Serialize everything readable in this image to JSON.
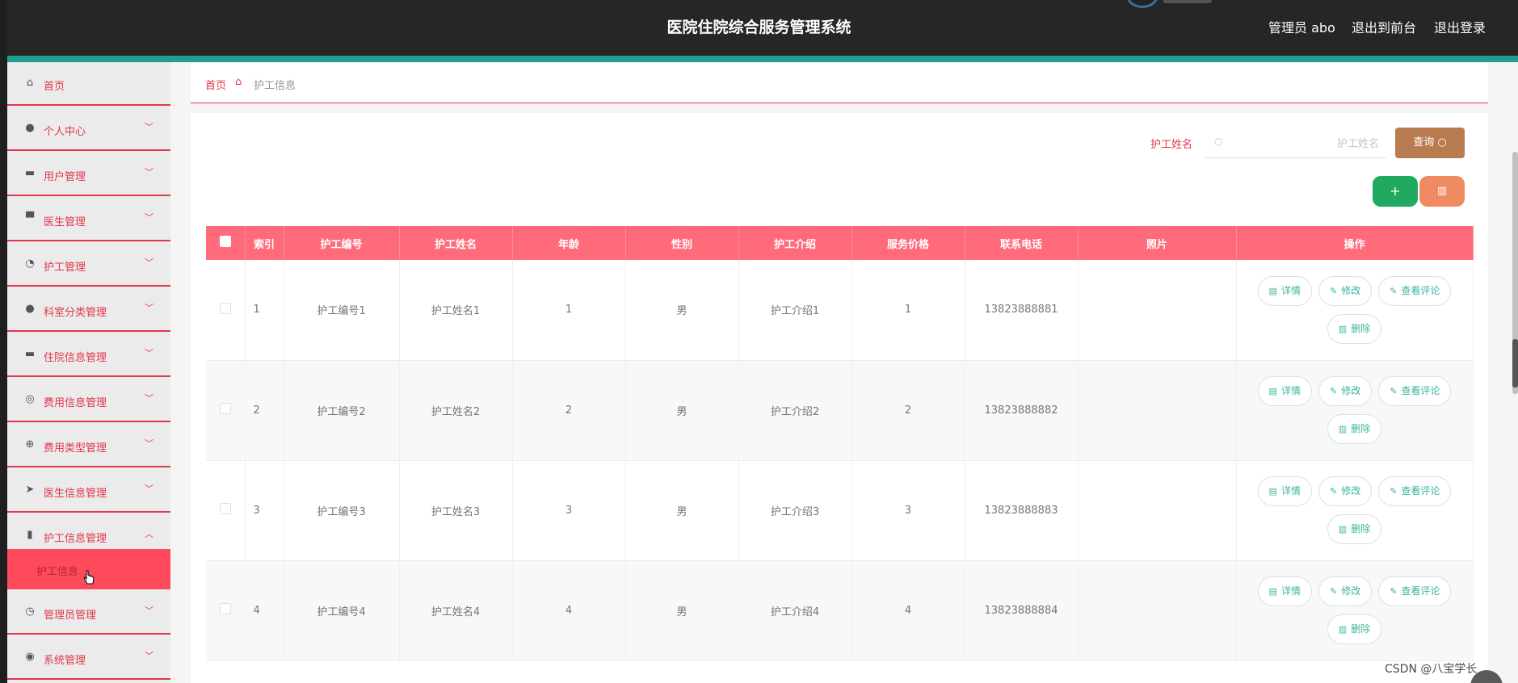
{
  "header": {
    "title": "医院住院综合服务管理系统",
    "admin_label": "管理员 abo",
    "to_front": "退出到前台",
    "logout": "退出登录"
  },
  "sidebar": {
    "items": [
      {
        "label": "首页",
        "icon": "home-icon",
        "glyph": "⌂",
        "has_chevron": false
      },
      {
        "label": "个人中心",
        "icon": "user-icon",
        "glyph": "●",
        "has_chevron": true
      },
      {
        "label": "用户管理",
        "icon": "ticket-icon",
        "glyph": "▬",
        "has_chevron": true
      },
      {
        "label": "医生管理",
        "icon": "monitor-icon",
        "glyph": "▀",
        "has_chevron": true
      },
      {
        "label": "护工管理",
        "icon": "dashboard-icon",
        "glyph": "◔",
        "has_chevron": true
      },
      {
        "label": "科室分类管理",
        "icon": "user-solid-icon",
        "glyph": "●",
        "has_chevron": true
      },
      {
        "label": "住院信息管理",
        "icon": "message-icon",
        "glyph": "▬",
        "has_chevron": true
      },
      {
        "label": "费用信息管理",
        "icon": "microphone-icon",
        "glyph": "◎",
        "has_chevron": true
      },
      {
        "label": "费用类型管理",
        "icon": "basketball-icon",
        "glyph": "⊕",
        "has_chevron": true
      },
      {
        "label": "医生信息管理",
        "icon": "send-icon",
        "glyph": "➤",
        "has_chevron": true
      },
      {
        "label": "护工信息管理",
        "icon": "bar-chart-icon",
        "glyph": "▮",
        "has_chevron": true,
        "expanded": true
      },
      {
        "label": "管理员管理",
        "icon": "clock-icon",
        "glyph": "◷",
        "has_chevron": true
      },
      {
        "label": "系统管理",
        "icon": "lifebuoy-icon",
        "glyph": "◉",
        "has_chevron": true
      }
    ],
    "submenu_active": "护工信息"
  },
  "breadcrumb": {
    "home": "首页",
    "current": "护工信息"
  },
  "search": {
    "label": "护工姓名",
    "placeholder": "护工姓名",
    "button": "查询"
  },
  "toolbar": {
    "add": "+",
    "delete_icon": "trash-icon"
  },
  "table": {
    "columns": [
      "索引",
      "护工编号",
      "护工姓名",
      "年龄",
      "性别",
      "护工介绍",
      "服务价格",
      "联系电话",
      "照片",
      "操作"
    ],
    "rows": [
      {
        "index": "1",
        "code": "护工编号1",
        "name": "护工姓名1",
        "age": "1",
        "gender": "男",
        "intro": "护工介绍1",
        "price": "1",
        "phone": "13823888881",
        "photo": ""
      },
      {
        "index": "2",
        "code": "护工编号2",
        "name": "护工姓名2",
        "age": "2",
        "gender": "男",
        "intro": "护工介绍2",
        "price": "2",
        "phone": "13823888882",
        "photo": ""
      },
      {
        "index": "3",
        "code": "护工编号3",
        "name": "护工姓名3",
        "age": "3",
        "gender": "男",
        "intro": "护工介绍3",
        "price": "3",
        "phone": "13823888883",
        "photo": ""
      },
      {
        "index": "4",
        "code": "护工编号4",
        "name": "护工姓名4",
        "age": "4",
        "gender": "男",
        "intro": "护工介绍4",
        "price": "4",
        "phone": "13823888884",
        "photo": ""
      }
    ],
    "actions": {
      "detail": "详情",
      "edit": "修改",
      "comments": "查看评论",
      "delete": "删除"
    }
  },
  "watermark": "CSDN @八宝学长",
  "colors": {
    "header_bg": "#262626",
    "accent_teal": "#1f9e8f",
    "accent_red": "#e2364a",
    "table_header": "#ff6b7a",
    "query_button": "#b87c50",
    "add_button": "#1faa5f",
    "delete_button": "#f08a63",
    "action_text": "#3ab49e"
  }
}
